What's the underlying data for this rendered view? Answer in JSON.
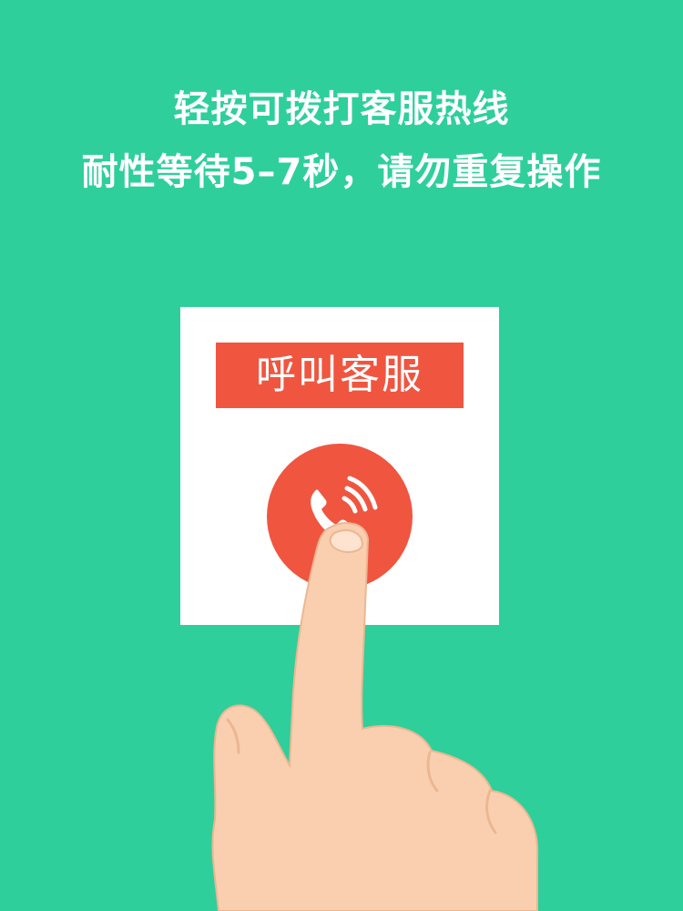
{
  "instructions": {
    "line1": "轻按可拨打客服热线",
    "line2": "耐性等待5–7秒，请勿重复操作"
  },
  "call_card": {
    "label": "呼叫客服",
    "button_icon": "phone-icon"
  },
  "colors": {
    "background": "#2ecf9b",
    "accent": "#f05540",
    "card": "#ffffff",
    "skin": "#f9cfb0"
  }
}
